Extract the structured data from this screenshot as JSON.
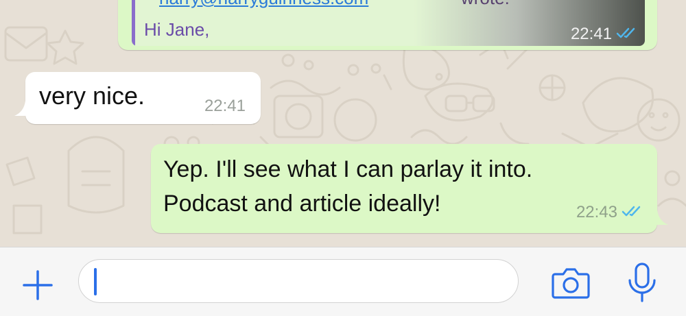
{
  "chat": {
    "quoted_message": {
      "link_text": "harry@harryguinness.com",
      "link_tail": "wrote:",
      "body": "Hi Jane,",
      "time": "22:41",
      "status_icon": "double-check-icon"
    },
    "incoming_message": {
      "text": "very nice.",
      "time": "22:41"
    },
    "outgoing_message": {
      "line1": "Yep. I'll see what I can parlay it into.",
      "line2": "Podcast and article ideally!",
      "time": "22:43",
      "status_icon": "double-check-icon"
    }
  },
  "input_bar": {
    "value": "",
    "plus_icon": "plus-icon",
    "camera_icon": "camera-icon",
    "mic_icon": "microphone-icon"
  },
  "colors": {
    "outgoing_bubble": "#dcf8c6",
    "incoming_bubble": "#ffffff",
    "accent": "#2b6fe8",
    "read_ticks": "#4fb6ec",
    "wallpaper": "#e7e0d6"
  }
}
